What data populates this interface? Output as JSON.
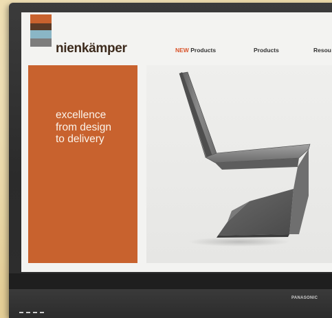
{
  "site": {
    "logo_text": "nienkämper",
    "logo_colors": [
      "#c8622e",
      "#5a3a26",
      "#8ab6c6",
      "#7d7d7d"
    ]
  },
  "nav": {
    "items": [
      {
        "prefix": "NEW",
        "label": "Products"
      },
      {
        "prefix": "",
        "label": "Products"
      },
      {
        "prefix": "",
        "label": "Resou"
      }
    ],
    "accent_color": "#d9532a"
  },
  "hero": {
    "tagline_lines": [
      "excellence",
      "from design",
      "to delivery"
    ],
    "panel_color": "#c8622e"
  },
  "device": {
    "brand": "PANASONIC"
  }
}
